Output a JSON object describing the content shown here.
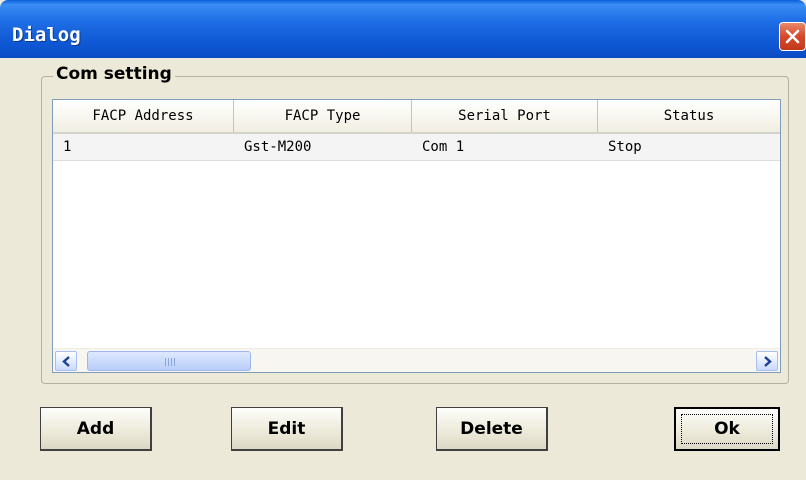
{
  "window": {
    "title": "Dialog",
    "close_icon": "close-icon"
  },
  "group": {
    "label": "Com setting"
  },
  "table": {
    "columns": [
      "FACP Address",
      "FACP Type",
      "Serial Port",
      "Status"
    ],
    "rows": [
      [
        "1",
        "Gst-M200",
        "Com 1",
        "Stop"
      ]
    ]
  },
  "scrollbar": {
    "left_icon": "chevron-left-icon",
    "right_icon": "chevron-right-icon"
  },
  "buttons": {
    "add": "Add",
    "edit": "Edit",
    "delete": "Delete",
    "ok": "Ok"
  },
  "colors": {
    "titlebar": "#0e57d4",
    "face": "#ece9d8",
    "close": "#d6482a"
  }
}
